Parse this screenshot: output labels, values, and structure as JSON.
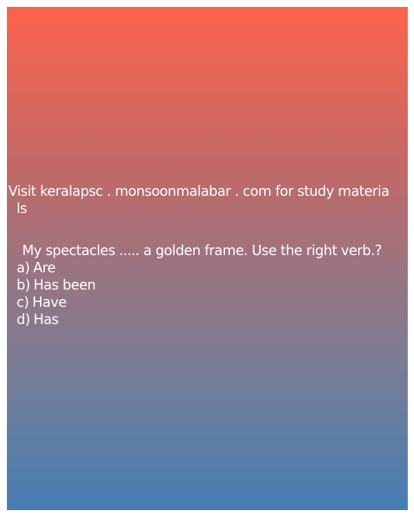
{
  "promo": {
    "line1": "Visit keralapsc . monsoonmalabar . com for study materia",
    "line2": "ls"
  },
  "question": "My spectacles ..... a golden frame. Use the right verb.?",
  "options": [
    {
      "label": "a)",
      "text": "Are"
    },
    {
      "label": "b)",
      "text": "Has been"
    },
    {
      "label": "c)",
      "text": "Have"
    },
    {
      "label": "d)",
      "text": "Has"
    }
  ],
  "colors": {
    "gradient_top": "#fd634c",
    "gradient_bottom": "#467eb2",
    "text": "#ffffff"
  }
}
